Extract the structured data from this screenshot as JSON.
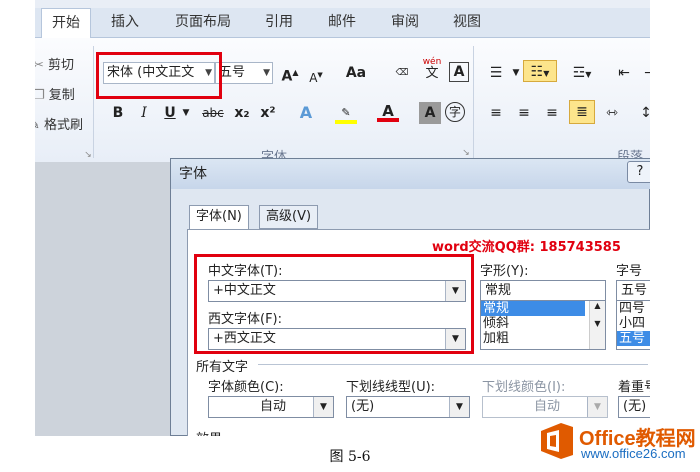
{
  "ribbon": {
    "tabs": [
      "开始",
      "插入",
      "页面布局",
      "引用",
      "邮件",
      "审阅",
      "视图"
    ],
    "clipboard": {
      "cut": "剪切",
      "copy": "复制",
      "format_painter": "格式刷"
    },
    "font_name": "宋体 (中文正文",
    "font_size": "五号",
    "group_font": "字体",
    "group_paragraph": "段落",
    "btn_bold": "B",
    "btn_italic": "I",
    "btn_underline": "U",
    "btn_strike": "abc",
    "btn_sub": "x₂",
    "btn_sup": "x²",
    "btn_grow": "A",
    "btn_shrink": "A",
    "btn_case": "Aa",
    "btn_phonetic": "wén",
    "btn_phonetic_char": "文",
    "btn_border": "A",
    "btn_fontcolor": "A",
    "btn_shade": "A",
    "btn_enclose": "字"
  },
  "dialog": {
    "title": "字体",
    "help": "?",
    "tabs": [
      "字体(N)",
      "高级(V)"
    ],
    "cn_font_label": "中文字体(T):",
    "cn_font_value": "+中文正文",
    "west_font_label": "西文字体(F):",
    "west_font_value": "+西文正文",
    "style_label": "字形(Y):",
    "style_value": "常规",
    "style_options": [
      "常规",
      "倾斜",
      "加粗"
    ],
    "size_label": "字号",
    "size_value": "五号",
    "size_options": [
      "四号",
      "小四",
      "五号"
    ],
    "all_text_label": "所有文字",
    "font_color_label": "字体颜色(C):",
    "font_color_value": "自动",
    "underline_label": "下划线线型(U):",
    "underline_value": "(无)",
    "underline_color_label": "下划线颜色(I):",
    "underline_color_value": "自动",
    "emphasis_label": "着重号",
    "emphasis_value": "(无)",
    "effects_label": "效果"
  },
  "annotation": "word交流QQ群: 185743585",
  "caption": "图 5-6",
  "logo": {
    "title": "Office教程网",
    "url": "www.office26.com"
  },
  "colors": {
    "highlight_red": "#e1000f",
    "selection_blue": "#3d8ce6",
    "logo_orange": "#e05a00"
  }
}
